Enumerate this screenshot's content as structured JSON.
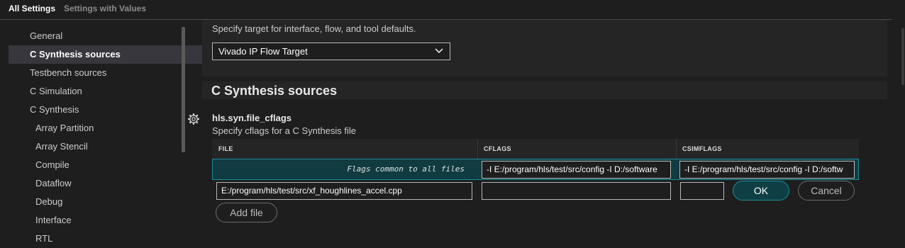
{
  "tabs": [
    {
      "label": "All Settings",
      "active": true
    },
    {
      "label": "Settings with Values",
      "active": false
    }
  ],
  "sidebar": {
    "items": [
      {
        "label": "General"
      },
      {
        "label": "C Synthesis sources",
        "selected": true
      },
      {
        "label": "Testbench sources"
      },
      {
        "label": "C Simulation"
      },
      {
        "label": "C Synthesis"
      },
      {
        "label": "Array Partition"
      },
      {
        "label": "Array Stencil"
      },
      {
        "label": "Compile"
      },
      {
        "label": "Dataflow"
      },
      {
        "label": "Debug"
      },
      {
        "label": "Interface"
      },
      {
        "label": "RTL"
      }
    ]
  },
  "flow_target": {
    "description": "Specify target for interface, flow, and tool defaults.",
    "selected": "Vivado IP Flow Target"
  },
  "section": {
    "title": "C Synthesis sources"
  },
  "setting": {
    "icon": "gear-icon",
    "key": "hls.syn.file_cflags",
    "description": "Specify cflags for a C Synthesis file"
  },
  "table": {
    "headers": [
      "FILE",
      "CFLAGS",
      "CSIMFLAGS"
    ],
    "common_row": {
      "label": "Flags common to all files",
      "cflags": "-I E:/program/hls/test/src/config -I D:/software",
      "csimflags": "-I E:/program/hls/test/src/config -I D:/softw"
    },
    "edit_row": {
      "file": "E:/program/hls/test/src/xf_houghlines_accel.cpp",
      "cflags": "",
      "csimflags": ""
    }
  },
  "buttons": {
    "ok": "OK",
    "cancel": "Cancel",
    "add_file": "Add file"
  },
  "colors": {
    "accent": "#1c8d99",
    "ok_bg": "#0e3f44",
    "row_highlight": "#103b40"
  }
}
